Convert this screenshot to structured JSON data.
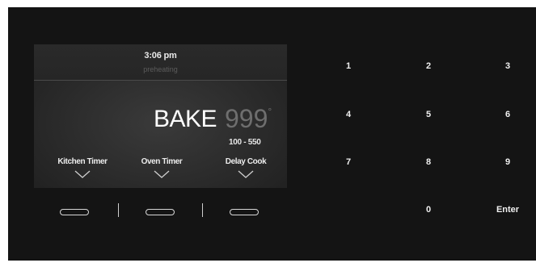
{
  "display": {
    "time": "3:06 pm",
    "status": "preheating",
    "mode": "BAKE",
    "temperature": "999",
    "degree_symbol": "°",
    "range": "100 - 550"
  },
  "options": [
    {
      "label": "Kitchen Timer"
    },
    {
      "label": "Oven Timer"
    },
    {
      "label": "Delay Cook"
    }
  ],
  "keypad": {
    "keys": [
      "1",
      "2",
      "3",
      "4",
      "5",
      "6",
      "7",
      "8",
      "9",
      "0",
      "Enter"
    ]
  },
  "colors": {
    "panel_background": "#141414",
    "display_background": "#2b2b2b",
    "temperature_text": "#6e6e6e",
    "status_text": "#5c5c5c"
  }
}
